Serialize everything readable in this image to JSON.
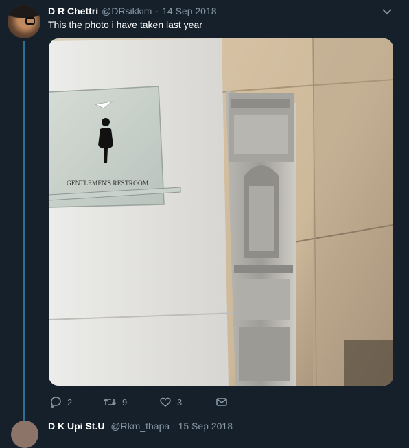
{
  "tweet": {
    "author_name": "D R Chettri",
    "handle": "@DRsikkim",
    "separator": "·",
    "date": "14 Sep 2018",
    "text": "This the photo i have taken last year",
    "photo": {
      "sign_text": "GENTLEMEN'S RESTROOM"
    },
    "actions": {
      "reply_count": "2",
      "retweet_count": "9",
      "like_count": "3"
    }
  },
  "next_tweet": {
    "author_name": "D K Upi St.U",
    "rest": "@Rkm_thapa · 15 Sep 2018"
  },
  "icons": {
    "reply": "reply-icon",
    "retweet": "retweet-icon",
    "like": "heart-icon",
    "message": "mail-icon",
    "more": "chevron-down-icon"
  },
  "colors": {
    "background": "#15202b",
    "muted": "#8899a6",
    "thread_line": "#2b6e96"
  }
}
